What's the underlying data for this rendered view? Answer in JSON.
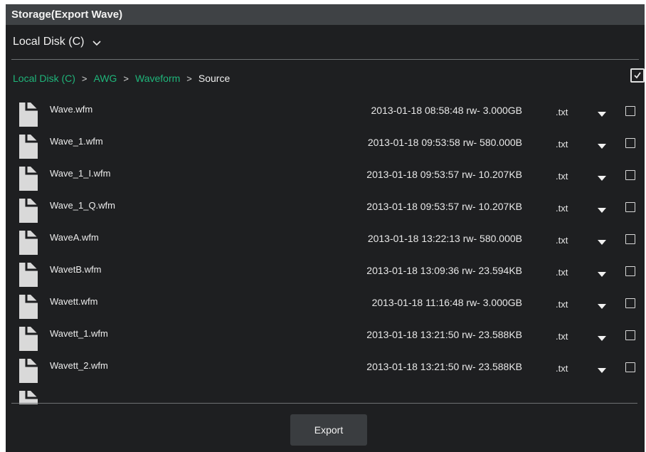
{
  "window": {
    "title": "Storage(Export Wave)"
  },
  "disk_select": {
    "value": "Local Disk (C)",
    "icon": "chevron-down-icon"
  },
  "breadcrumb": [
    {
      "label": "Local Disk (C)",
      "current": false
    },
    {
      "label": "AWG",
      "current": false
    },
    {
      "label": "Waveform",
      "current": false
    },
    {
      "label": "Source",
      "current": true
    }
  ],
  "breadcrumb_separator": ">",
  "select_all": {
    "checked": true
  },
  "files": [
    {
      "name": "Wave.wfm",
      "meta": "2013-01-18 08:58:48 rw- 3.000GB",
      "ext": ".txt",
      "checked": false
    },
    {
      "name": "Wave_1.wfm",
      "meta": "2013-01-18 09:53:58 rw- 580.000B",
      "ext": ".txt",
      "checked": false
    },
    {
      "name": "Wave_1_I.wfm",
      "meta": "2013-01-18 09:53:57 rw- 10.207KB",
      "ext": ".txt",
      "checked": false
    },
    {
      "name": "Wave_1_Q.wfm",
      "meta": "2013-01-18 09:53:57 rw- 10.207KB",
      "ext": ".txt",
      "checked": false
    },
    {
      "name": "WaveA.wfm",
      "meta": "2013-01-18 13:22:13 rw- 580.000B",
      "ext": ".txt",
      "checked": false
    },
    {
      "name": "WavetB.wfm",
      "meta": "2013-01-18 13:09:36 rw- 23.594KB",
      "ext": ".txt",
      "checked": false
    },
    {
      "name": "Wavett.wfm",
      "meta": "2013-01-18 11:16:48 rw- 3.000GB",
      "ext": ".txt",
      "checked": false
    },
    {
      "name": "Wavett_1.wfm",
      "meta": "2013-01-18 13:21:50 rw- 23.588KB",
      "ext": ".txt",
      "checked": false
    },
    {
      "name": "Wavett_2.wfm",
      "meta": "2013-01-18 13:21:50 rw- 23.588KB",
      "ext": ".txt",
      "checked": false
    }
  ],
  "export_button": {
    "label": "Export"
  },
  "colors": {
    "accent": "#1fb57a",
    "background": "#1e1f21",
    "titlebar": "#3f4245",
    "button": "#3a3d40"
  }
}
